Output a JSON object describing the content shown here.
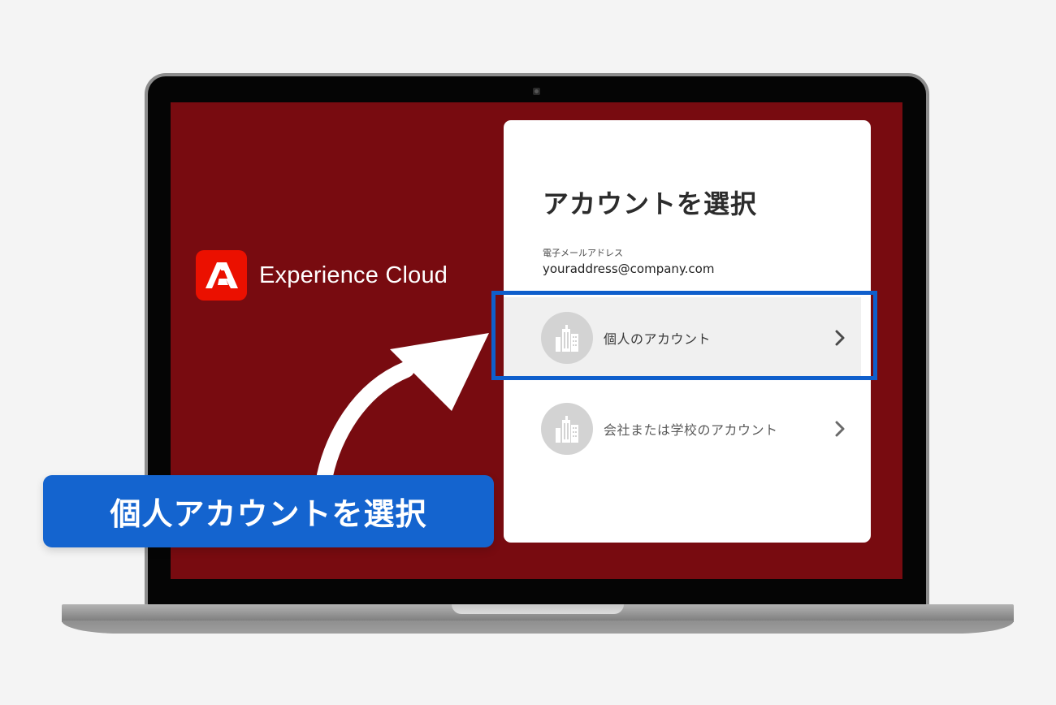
{
  "brand": {
    "name": "Experience Cloud",
    "logo_color": "#eb1000"
  },
  "card": {
    "title": "アカウントを選択",
    "email_label": "電子メールアドレス",
    "email_value": "youraddress@company.com",
    "accounts": [
      {
        "label": "個人のアカウント",
        "icon": "building-icon",
        "highlighted": true
      },
      {
        "label": "会社または学校のアカウント",
        "icon": "building-icon",
        "highlighted": false
      }
    ]
  },
  "callout": {
    "text": "個人アカウントを選択",
    "color": "#1464cf"
  },
  "colors": {
    "screen_background": "#780b10",
    "highlight_border": "#0f5fcc"
  }
}
